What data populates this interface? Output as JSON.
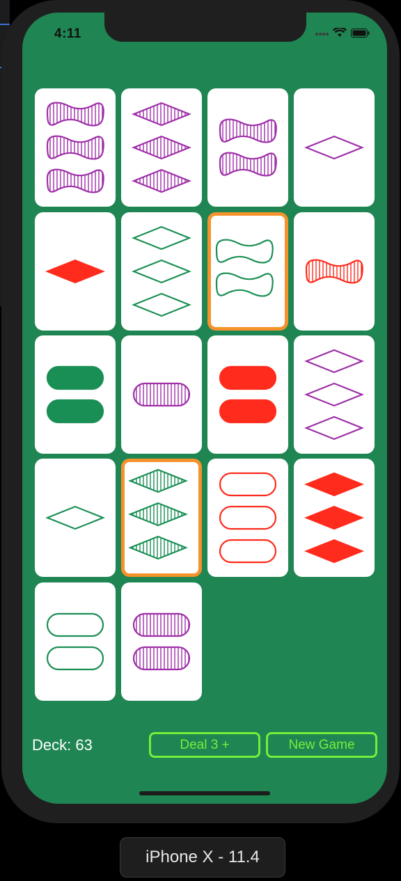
{
  "status_bar": {
    "time": "4:11"
  },
  "colors": {
    "background": "#1f8552",
    "purple": "#9e2ea8",
    "green": "#1a8f55",
    "red": "#ff2b1c",
    "selection": "#f5922b",
    "button": "#73f03a"
  },
  "cards": [
    {
      "count": 3,
      "shape": "squiggle",
      "shading": "striped",
      "color": "purple",
      "selected": false
    },
    {
      "count": 3,
      "shape": "diamond",
      "shading": "striped",
      "color": "purple",
      "selected": false
    },
    {
      "count": 2,
      "shape": "squiggle",
      "shading": "striped",
      "color": "purple",
      "selected": false
    },
    {
      "count": 1,
      "shape": "diamond",
      "shading": "open",
      "color": "purple",
      "selected": false
    },
    {
      "count": 1,
      "shape": "diamond",
      "shading": "solid",
      "color": "red",
      "selected": false
    },
    {
      "count": 3,
      "shape": "diamond",
      "shading": "open",
      "color": "green",
      "selected": false
    },
    {
      "count": 2,
      "shape": "squiggle",
      "shading": "open",
      "color": "green",
      "selected": true
    },
    {
      "count": 1,
      "shape": "squiggle",
      "shading": "striped",
      "color": "red",
      "selected": false
    },
    {
      "count": 2,
      "shape": "oval",
      "shading": "solid",
      "color": "green",
      "selected": false
    },
    {
      "count": 1,
      "shape": "oval",
      "shading": "striped",
      "color": "purple",
      "selected": false
    },
    {
      "count": 2,
      "shape": "oval",
      "shading": "solid",
      "color": "red",
      "selected": false
    },
    {
      "count": 3,
      "shape": "diamond",
      "shading": "open",
      "color": "purple",
      "selected": false
    },
    {
      "count": 1,
      "shape": "diamond",
      "shading": "open",
      "color": "green",
      "selected": false
    },
    {
      "count": 3,
      "shape": "diamond",
      "shading": "striped",
      "color": "green",
      "selected": true
    },
    {
      "count": 3,
      "shape": "oval",
      "shading": "open",
      "color": "red",
      "selected": false
    },
    {
      "count": 3,
      "shape": "diamond",
      "shading": "solid",
      "color": "red",
      "selected": false
    },
    {
      "count": 2,
      "shape": "oval",
      "shading": "open",
      "color": "green",
      "selected": false
    },
    {
      "count": 2,
      "shape": "oval",
      "shading": "striped",
      "color": "purple",
      "selected": false
    }
  ],
  "footer": {
    "deck_label": "Deck: 63",
    "deal_label": "Deal 3 +",
    "new_game_label": "New Game"
  },
  "device_label": "iPhone X - 11.4"
}
